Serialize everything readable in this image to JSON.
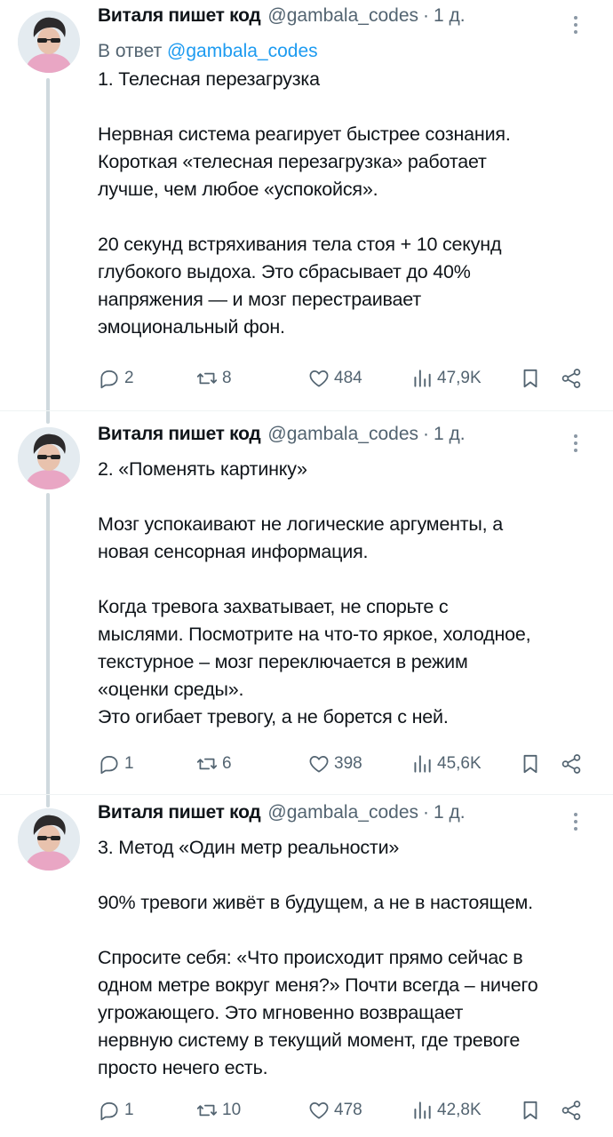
{
  "tweets": [
    {
      "author": "Виталя пишет код",
      "handle": "@gambala_codes",
      "separator": "·",
      "time": "1 д.",
      "reply_prefix": "В ответ",
      "reply_mention": "@gambala_codes",
      "text": "1. Телесная перезагрузка\n\nНервная система реагирует быстрее сознания.\nКороткая «телесная перезагрузка» работает\nлучше, чем любое «успокойся».\n\n20 секунд встряхивания тела стоя + 10 секунд\nглубокого выдоха. Это сбрасывает до 40%\nнапряжения — и мозг перестраивает\nэмоциональный фон.",
      "replies": "2",
      "retweets": "8",
      "likes": "484",
      "views": "47,9K"
    },
    {
      "author": "Виталя пишет код",
      "handle": "@gambala_codes",
      "separator": "·",
      "time": "1 д.",
      "text": "2. «Поменять картинку»\n\nМозг успокаивают не логические аргументы, а\nновая сенсорная информация.\n\nКогда тревога захватывает, не спорьте с\nмыслями. Посмотрите на что-то яркое, холодное,\nтекстурное – мозг переключается в режим\n«оценки среды».\nЭто огибает тревогу, а не борется с ней.",
      "replies": "1",
      "retweets": "6",
      "likes": "398",
      "views": "45,6K"
    },
    {
      "author": "Виталя пишет код",
      "handle": "@gambala_codes",
      "separator": "·",
      "time": "1 д.",
      "text": "3. Метод «Один метр реальности»\n\n90% тревоги живёт в будущем, а не в настоящем.\n\nСпросите себя: «Что происходит прямо сейчас в\nодном метре вокруг меня?» Почти всегда – ничего\nугрожающего. Это мгновенно возвращает\nнервную систему в текущий момент, где тревоге\nпросто нечего есть.",
      "replies": "1",
      "retweets": "10",
      "likes": "478",
      "views": "42,8K"
    }
  ],
  "icons": {
    "reply": "reply-icon",
    "retweet": "retweet-icon",
    "like": "heart-icon",
    "views": "views-icon",
    "bookmark": "bookmark-icon",
    "share": "share-icon",
    "more": "more-icon"
  },
  "colors": {
    "text": "#0f1419",
    "secondary": "#536471",
    "link": "#1d9bf0",
    "thread_line": "#cfd9de"
  }
}
